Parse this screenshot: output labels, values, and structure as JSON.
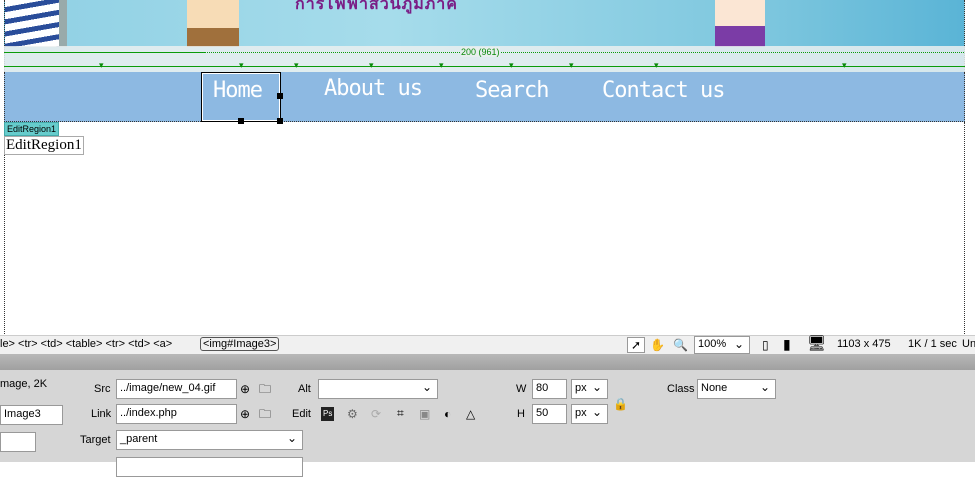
{
  "banner": {
    "title": "การไฟฟ้าส่วนภูมิภาค"
  },
  "ruler": {
    "width_label": "200 (961)"
  },
  "nav": {
    "items": [
      "Home",
      "About us",
      "Search",
      "Contact us"
    ]
  },
  "edit_region": {
    "label": "EditRegion1",
    "content": "EditRegion1"
  },
  "status_bar": {
    "tag_path": "le> <tr> <td> <table> <tr> <td> <a>",
    "selected_tag": "<img#Image3>",
    "zoom": "100%",
    "window_size": "1103 x 475",
    "download": "1K / 1 sec",
    "encoding": "Un"
  },
  "properties": {
    "type": "mage, 2K",
    "id": "Image3",
    "src_label": "Src",
    "src": "../image/new_04.gif",
    "link_label": "Link",
    "link": "../index.php",
    "target_label": "Target",
    "target": "_parent",
    "alt_label": "Alt",
    "alt": "",
    "edit_label": "Edit",
    "w_label": "W",
    "w": "80",
    "h_label": "H",
    "h": "50",
    "unit_w": "px",
    "unit_h": "px",
    "class_label": "Class",
    "class": "None"
  }
}
